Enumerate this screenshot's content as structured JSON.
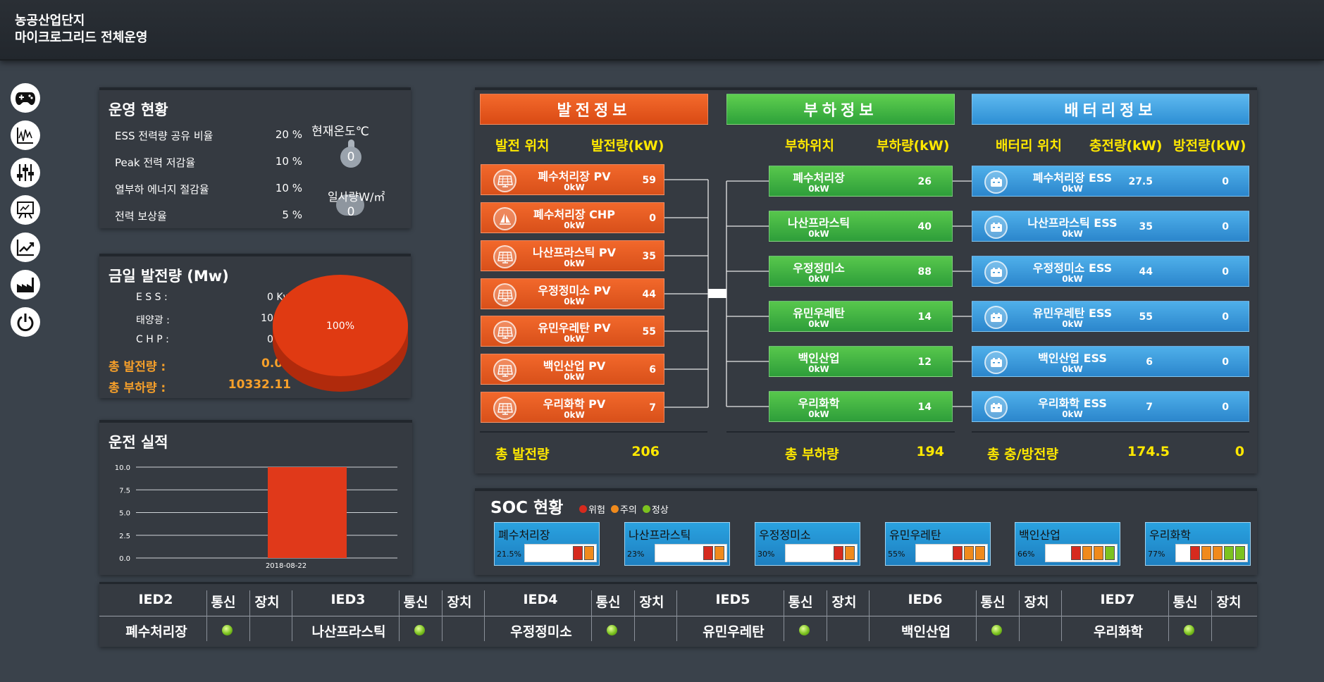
{
  "app": {
    "title_line1": "농공산업단지",
    "title_line2": "마이크로그리드 전체운영"
  },
  "sidebar": [
    "gamepad-icon",
    "waveform-chart-icon",
    "sliders-icon",
    "presentation-board-icon",
    "line-chart-icon",
    "factory-icon",
    "power-icon"
  ],
  "ops": {
    "title": "운영 현황",
    "rows": [
      {
        "label": "ESS 전력량 공유 비율",
        "value": "20 %"
      },
      {
        "label": "Peak 전력 저감율",
        "value": "10 %"
      },
      {
        "label": "열부하 에너지 절감율",
        "value": "10 %"
      },
      {
        "label": "전력 보상율",
        "value": "5 %"
      }
    ],
    "temp_label": "현재온도℃",
    "temp_value": "0",
    "sun_label": "일사량W/㎡",
    "sun_value": "0"
  },
  "daily": {
    "title": "금일 발전량 (Mw)",
    "rows": [
      {
        "label": "E S S :",
        "value": "0 Kw"
      },
      {
        "label": "태양광 :",
        "value": "10 Kw"
      },
      {
        "label": "C H P :",
        "value": "0 Kw"
      }
    ],
    "total_gen_label": "총 발전량 :",
    "total_gen": "0.01",
    "total_load_label": "총 부하량 :",
    "total_load": "10332.11",
    "pie_label": "100%"
  },
  "record": {
    "title": "운전 실적",
    "y_ticks": [
      "10.0",
      "7.5",
      "5.0",
      "2.5",
      "0.0"
    ],
    "x_label": "2018-08-22"
  },
  "chart_data": {
    "type": "bar",
    "categories": [
      "2018-08-22"
    ],
    "values": [
      10
    ],
    "ylim": [
      0,
      10
    ],
    "title": "",
    "xlabel": "",
    "ylabel": "",
    "grid": true
  },
  "gen": {
    "header": "발전정보",
    "col1": "발전 위치",
    "col2": "발전량(kW)",
    "items": [
      {
        "name": "폐수처리장 PV",
        "sub": "0kW",
        "value": "59",
        "icon": "solar-panel-icon"
      },
      {
        "name": "폐수처리장 CHP",
        "sub": "0kW",
        "value": "0",
        "icon": "sailboat-icon"
      },
      {
        "name": "나산프라스틱 PV",
        "sub": "0kW",
        "value": "35",
        "icon": "solar-panel-icon"
      },
      {
        "name": "우정정미소 PV",
        "sub": "0kW",
        "value": "44",
        "icon": "solar-panel-icon"
      },
      {
        "name": "유민우레탄 PV",
        "sub": "0kW",
        "value": "55",
        "icon": "solar-panel-icon"
      },
      {
        "name": "백인산업 PV",
        "sub": "0kW",
        "value": "6",
        "icon": "solar-panel-icon"
      },
      {
        "name": "우리화학 PV",
        "sub": "0kW",
        "value": "7",
        "icon": "solar-panel-icon"
      }
    ],
    "total_label": "총 발전량",
    "total": "206"
  },
  "load": {
    "header": "부하정보",
    "col1": "부하위치",
    "col2": "부하량(kW)",
    "items": [
      {
        "name": "폐수처리장",
        "sub": "0kW",
        "value": "26"
      },
      {
        "name": "나산프라스틱",
        "sub": "0kW",
        "value": "40"
      },
      {
        "name": "우정정미소",
        "sub": "0kW",
        "value": "88"
      },
      {
        "name": "유민우레탄",
        "sub": "0kW",
        "value": "14"
      },
      {
        "name": "백인산업",
        "sub": "0kW",
        "value": "12"
      },
      {
        "name": "우리화학",
        "sub": "0kW",
        "value": "14"
      }
    ],
    "total_label": "총 부하량",
    "total": "194"
  },
  "batt": {
    "header": "배터리정보",
    "col1": "배터리 위치",
    "col2": "충전량(kW)",
    "col3": "방전량(kW)",
    "items": [
      {
        "name": "폐수처리장 ESS",
        "sub": "0kW",
        "charge": "27.5",
        "discharge": "0"
      },
      {
        "name": "나산프라스틱 ESS",
        "sub": "0kW",
        "charge": "35",
        "discharge": "0"
      },
      {
        "name": "우정정미소 ESS",
        "sub": "0kW",
        "charge": "44",
        "discharge": "0"
      },
      {
        "name": "유민우레탄 ESS",
        "sub": "0kW",
        "charge": "55",
        "discharge": "0"
      },
      {
        "name": "백인산업 ESS",
        "sub": "0kW",
        "charge": "6",
        "discharge": "0"
      },
      {
        "name": "우리화학 ESS",
        "sub": "0kW",
        "charge": "7",
        "discharge": "0"
      }
    ],
    "total_label": "총 충/방전량",
    "total_charge": "174.5",
    "total_discharge": "0"
  },
  "soc": {
    "title": "SOC 현황",
    "legend": [
      {
        "label": "위험",
        "color": "#d62a1e"
      },
      {
        "label": "주의",
        "color": "#f08a1c"
      },
      {
        "label": "정상",
        "color": "#7cc21f"
      }
    ],
    "items": [
      {
        "name": "폐수처리장",
        "pct": "21.5%",
        "level": 0.215
      },
      {
        "name": "나산프라스틱",
        "pct": "23%",
        "level": 0.23
      },
      {
        "name": "우정정미소",
        "pct": "30%",
        "level": 0.3
      },
      {
        "name": "유민우레탄",
        "pct": "55%",
        "level": 0.55
      },
      {
        "name": "백인산업",
        "pct": "66%",
        "level": 0.66
      },
      {
        "name": "우리화학",
        "pct": "77%",
        "level": 0.77
      }
    ]
  },
  "ied": {
    "comm_label": "통신",
    "device_label": "장치",
    "items": [
      {
        "id": "IED2",
        "site": "폐수처리장"
      },
      {
        "id": "IED3",
        "site": "나산프라스틱"
      },
      {
        "id": "IED4",
        "site": "우정정미소"
      },
      {
        "id": "IED5",
        "site": "유민우레탄"
      },
      {
        "id": "IED6",
        "site": "백인산업"
      },
      {
        "id": "IED7",
        "site": "우리화학"
      }
    ]
  }
}
